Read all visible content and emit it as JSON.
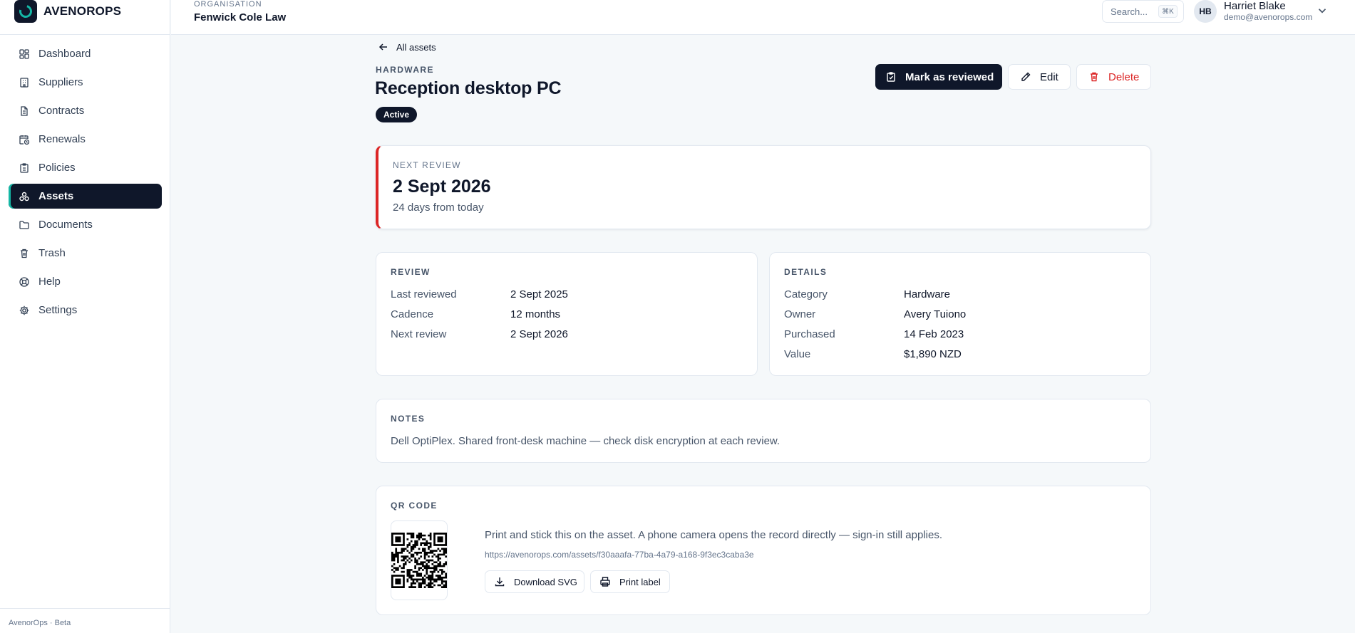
{
  "brand": {
    "name": "AVENOROPS",
    "logo_icon": "avenorops-logo",
    "accent": "#14b8a6"
  },
  "sidebar": {
    "items": [
      {
        "label": "Dashboard",
        "icon": "dashboard-icon",
        "active": false
      },
      {
        "label": "Suppliers",
        "icon": "building-icon",
        "active": false
      },
      {
        "label": "Contracts",
        "icon": "document-icon",
        "active": false
      },
      {
        "label": "Renewals",
        "icon": "calendar-clock-icon",
        "active": false
      },
      {
        "label": "Policies",
        "icon": "clipboard-icon",
        "active": false
      },
      {
        "label": "Assets",
        "icon": "boxes-icon",
        "active": true
      },
      {
        "label": "Documents",
        "icon": "folder-icon",
        "active": false
      },
      {
        "label": "Trash",
        "icon": "trash-icon",
        "active": false
      },
      {
        "label": "Help",
        "icon": "lifebuoy-icon",
        "active": false
      },
      {
        "label": "Settings",
        "icon": "gear-icon",
        "active": false
      }
    ],
    "footer": "AvenorOps · Beta"
  },
  "topbar": {
    "org_label": "ORGANISATION",
    "org_name": "Fenwick Cole Law",
    "search_placeholder": "Search...",
    "search_shortcut": "⌘K",
    "user": {
      "initials": "HB",
      "name": "Harriet Blake",
      "email": "demo@avenorops.com"
    }
  },
  "asset": {
    "back_label": "All assets",
    "category": "HARDWARE",
    "title": "Reception desktop PC",
    "status": "Active",
    "actions": {
      "mark_reviewed": "Mark as reviewed",
      "edit": "Edit",
      "delete": "Delete"
    }
  },
  "next_review": {
    "label": "NEXT REVIEW",
    "date": "2 Sept 2026",
    "relative": "24 days from today",
    "accent": "#dc2626"
  },
  "review": {
    "label": "REVIEW",
    "rows": [
      {
        "key": "Last reviewed",
        "value": "2 Sept 2025"
      },
      {
        "key": "Cadence",
        "value": "12 months"
      },
      {
        "key": "Next review",
        "value": "2 Sept 2026"
      }
    ]
  },
  "details": {
    "label": "DETAILS",
    "rows": [
      {
        "key": "Category",
        "value": "Hardware"
      },
      {
        "key": "Owner",
        "value": "Avery Tuiono"
      },
      {
        "key": "Purchased",
        "value": "14 Feb 2023"
      },
      {
        "key": "Value",
        "value": "$1,890 NZD"
      }
    ]
  },
  "notes": {
    "label": "NOTES",
    "text": "Dell OptiPlex. Shared front-desk machine — check disk encryption at each review."
  },
  "qr": {
    "label": "QR CODE",
    "description": "Print and stick this on the asset. A phone camera opens the record directly — sign-in still applies.",
    "url": "https://avenorops.com/assets/f30aaafa-77ba-4a79-a168-9f3ec3caba3e",
    "download_label": "Download SVG",
    "print_label": "Print label"
  }
}
